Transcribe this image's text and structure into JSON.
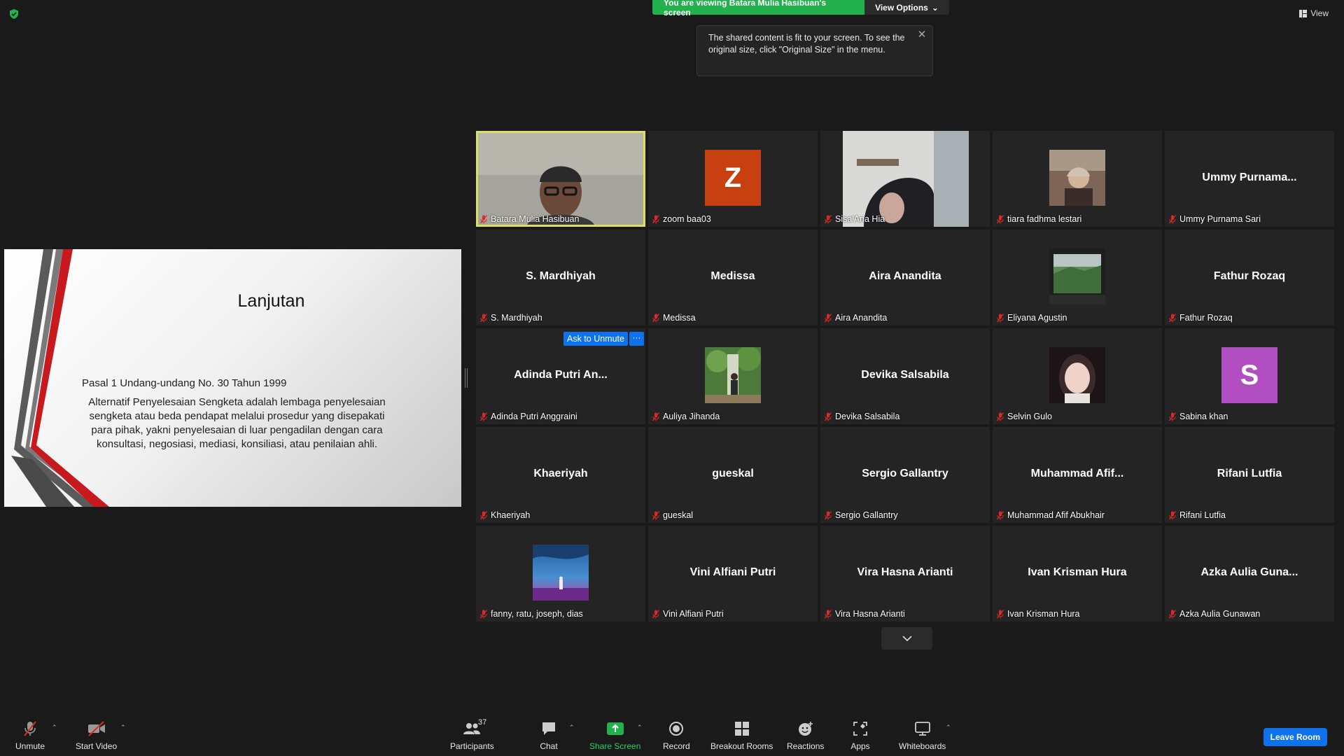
{
  "banner": {
    "viewing_text": "You are viewing Batara Mulia Hasibuan's screen",
    "options_label": "View Options"
  },
  "view_label": "View",
  "tooltip": {
    "text": "The shared content is fit to your screen. To see the original size, click \"Original Size\" in the menu."
  },
  "slide": {
    "title": "Lanjutan",
    "subtitle": "Pasal 1 Undang-undang No. 30 Tahun 1999",
    "body": "Alternatif Penyelesaian Sengketa adalah lembaga penyelesaian sengketa atau beda pendapat melalui prosedur yang disepakati para pihak, yakni penyelesaian di luar pengadilan dengan cara konsultasi, negosiasi, mediasi, konsiliasi, atau penilaian ahli."
  },
  "participants": [
    {
      "label": "Batara Mulia Hasibuan",
      "big": "",
      "type": "video-main"
    },
    {
      "label": "zoom baa03",
      "big": "",
      "type": "letter",
      "letter": "Z",
      "color": "#c8400f"
    },
    {
      "label": "Sisa'Ana Hia",
      "big": "",
      "type": "video-sisa"
    },
    {
      "label": "tiara fadhma lestari",
      "big": "",
      "type": "photo-room"
    },
    {
      "label": "Ummy Purnama Sari",
      "big": "Ummy  Purnama...",
      "type": "name"
    },
    {
      "label": "S. Mardhiyah",
      "big": "S. Mardhiyah",
      "type": "name"
    },
    {
      "label": "Medissa",
      "big": "Medissa",
      "type": "name"
    },
    {
      "label": "Aira Anandita",
      "big": "Aira Anandita",
      "type": "name"
    },
    {
      "label": "Eliyana Agustin",
      "big": "",
      "type": "photo-window"
    },
    {
      "label": "Fathur Rozaq",
      "big": "Fathur Rozaq",
      "type": "name"
    },
    {
      "label": "Adinda Putri Anggraini",
      "big": "Adinda  Putri  An...",
      "type": "name-ask"
    },
    {
      "label": "Auliya Jihanda",
      "big": "",
      "type": "photo-garden"
    },
    {
      "label": "Devika Salsabila",
      "big": "Devika Salsabila",
      "type": "name"
    },
    {
      "label": "Selvin Gulo",
      "big": "",
      "type": "photo-face"
    },
    {
      "label": "Sabina khan",
      "big": "",
      "type": "letter",
      "letter": "S",
      "color": "#b04ec2"
    },
    {
      "label": "Khaeriyah",
      "big": "Khaeriyah",
      "type": "name"
    },
    {
      "label": "gueskal",
      "big": "gueskal",
      "type": "name"
    },
    {
      "label": "Sergio Gallantry",
      "big": "Sergio Gallantry",
      "type": "name"
    },
    {
      "label": "Muhammad Afif Abukhair",
      "big": "Muhammad  Afif...",
      "type": "name"
    },
    {
      "label": "Rifani Lutfia",
      "big": "Rifani Lutfia",
      "type": "name"
    },
    {
      "label": "fanny, ratu, joseph, dias",
      "big": "",
      "type": "photo-sky"
    },
    {
      "label": "Vini Alfiani Putri",
      "big": "Vini Alfiani Putri",
      "type": "name"
    },
    {
      "label": "Vira Hasna Arianti",
      "big": "Vira Hasna Arianti",
      "type": "name"
    },
    {
      "label": "Ivan Krisman Hura",
      "big": "Ivan Krisman Hura",
      "type": "name"
    },
    {
      "label": "Azka Aulia Gunawan",
      "big": "Azka  Aulia  Guna...",
      "type": "name"
    }
  ],
  "ask_to_unmute_label": "Ask to Unmute",
  "more_label": "···",
  "toolbar": {
    "unmute": "Unmute",
    "start_video": "Start Video",
    "participants": "Participants",
    "participants_count": "37",
    "chat": "Chat",
    "share_screen": "Share Screen",
    "record": "Record",
    "breakout_rooms": "Breakout Rooms",
    "reactions": "Reactions",
    "apps": "Apps",
    "whiteboards": "Whiteboards",
    "leave": "Leave Room"
  },
  "colors": {
    "share_green": "#23b14d",
    "leave_blue": "#0e72ed",
    "active_speaker": "#d9e063"
  }
}
